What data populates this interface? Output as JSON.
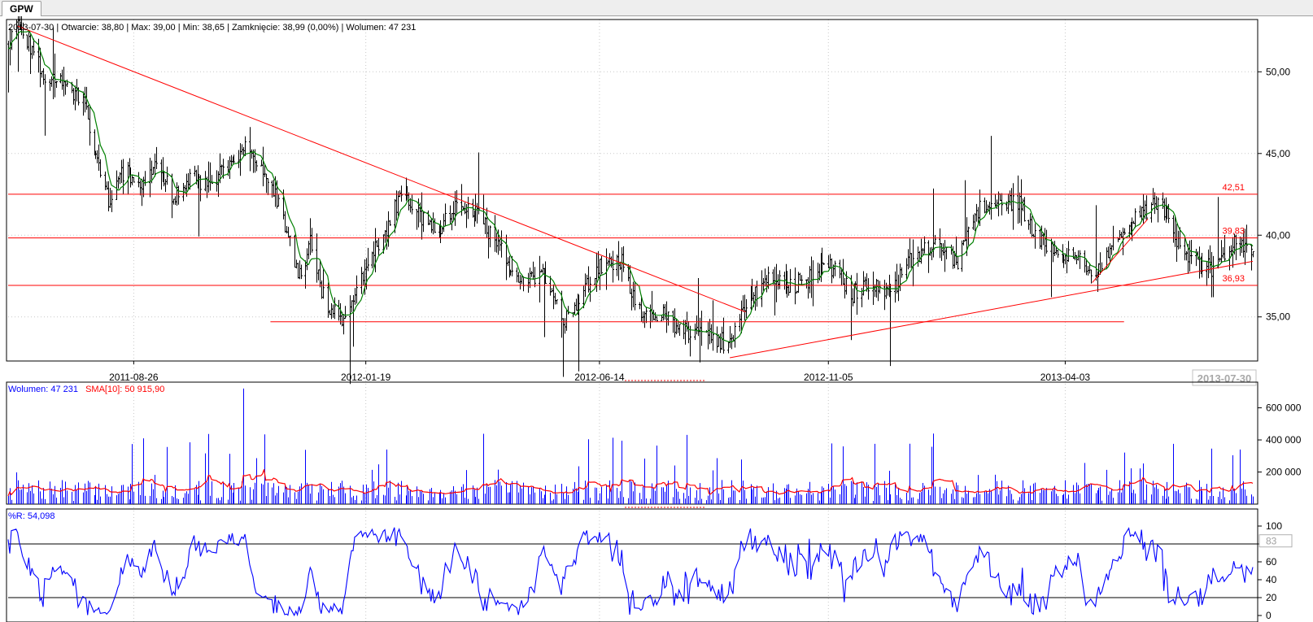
{
  "tab": {
    "label": "GPW"
  },
  "info": {
    "ohlc": "2013-07-30 | Otwarcie: 38,80 | Max: 39,00 | Min: 38,65 | Zamknięcie: 38,99 (0,00%) | Wolumen: 47 231",
    "volume_label": "Wolumen: 47 231",
    "sma_label": "SMA[10]: 50 915,90",
    "wr_label": "%R: 54,098"
  },
  "colors": {
    "candle": "#000000",
    "sma": "#008000",
    "line": "#ff0000",
    "volume": "#0000ff",
    "wr": "#0000ff"
  },
  "chart_data": [
    {
      "type": "candlestick",
      "y_ticks": [
        "50,00",
        "45,00",
        "40,00",
        "35,00"
      ],
      "y_tick_values": [
        50,
        45,
        40,
        35
      ],
      "ylim": [
        32.3,
        53.2
      ],
      "x_ticks": [
        "2011-08-26",
        "2012-01-19",
        "2012-06-14",
        "2012-11-05",
        "2013-04-03"
      ],
      "x_tick_values": [
        "2011-08-26",
        "2012-01-19",
        "2012-06-14",
        "2012-11-05",
        "2013-04-03"
      ],
      "last_date": "2013-07-30",
      "x_range": [
        "2011-06-08",
        "2013-07-30"
      ],
      "price_path": [
        [
          "2011-06-08",
          51.7
        ],
        [
          "2011-06-14",
          52.8
        ],
        [
          "2011-06-22",
          51.5
        ],
        [
          "2011-07-02",
          49.5
        ],
        [
          "2011-07-12",
          49.2
        ],
        [
          "2011-07-25",
          48.3
        ],
        [
          "2011-08-01",
          45.0
        ],
        [
          "2011-08-10",
          42.0
        ],
        [
          "2011-08-20",
          44.0
        ],
        [
          "2011-09-01",
          43.0
        ],
        [
          "2011-09-10",
          44.5
        ],
        [
          "2011-09-20",
          42.3
        ],
        [
          "2011-10-01",
          43.5
        ],
        [
          "2011-10-12",
          43.0
        ],
        [
          "2011-10-25",
          44.5
        ],
        [
          "2011-11-05",
          45.3
        ],
        [
          "2011-11-20",
          43.5
        ],
        [
          "2011-11-30",
          40.0
        ],
        [
          "2011-12-08",
          37.5
        ],
        [
          "2011-12-15",
          39.5
        ],
        [
          "2011-12-25",
          35.5
        ],
        [
          "2012-01-05",
          35.0
        ],
        [
          "2012-01-19",
          38.0
        ],
        [
          "2012-02-01",
          40.5
        ],
        [
          "2012-02-10",
          42.5
        ],
        [
          "2012-02-20",
          41.3
        ],
        [
          "2012-03-05",
          40.5
        ],
        [
          "2012-03-15",
          41.8
        ],
        [
          "2012-03-28",
          41.5
        ],
        [
          "2012-04-10",
          39.5
        ],
        [
          "2012-04-25",
          37.0
        ],
        [
          "2012-05-10",
          37.5
        ],
        [
          "2012-05-22",
          34.5
        ],
        [
          "2012-06-02",
          36.5
        ],
        [
          "2012-06-14",
          38.0
        ],
        [
          "2012-06-28",
          38.3
        ],
        [
          "2012-07-08",
          35.5
        ],
        [
          "2012-07-25",
          35.0
        ],
        [
          "2012-08-08",
          34.0
        ],
        [
          "2012-08-25",
          33.8
        ],
        [
          "2012-09-04",
          33.2
        ],
        [
          "2012-09-14",
          36.0
        ],
        [
          "2012-09-28",
          37.2
        ],
        [
          "2012-10-15",
          37.0
        ],
        [
          "2012-10-28",
          37.5
        ],
        [
          "2012-11-05",
          38.3
        ],
        [
          "2012-11-20",
          36.4
        ],
        [
          "2012-12-01",
          37.2
        ],
        [
          "2012-12-15",
          36.3
        ],
        [
          "2012-12-25",
          38.5
        ],
        [
          "2013-01-10",
          39.3
        ],
        [
          "2013-01-25",
          38.5
        ],
        [
          "2013-02-05",
          41.5
        ],
        [
          "2013-02-15",
          42.0
        ],
        [
          "2013-03-05",
          42.0
        ],
        [
          "2013-03-15",
          40.0
        ],
        [
          "2013-03-28",
          38.8
        ],
        [
          "2013-04-10",
          39.0
        ],
        [
          "2013-04-20",
          37.2
        ],
        [
          "2013-04-30",
          39.0
        ],
        [
          "2013-05-15",
          40.8
        ],
        [
          "2013-05-28",
          41.8
        ],
        [
          "2013-06-08",
          41.5
        ],
        [
          "2013-06-14",
          39.0
        ],
        [
          "2013-06-25",
          38.3
        ],
        [
          "2013-07-05",
          38.0
        ],
        [
          "2013-07-16",
          39.5
        ],
        [
          "2013-07-30",
          38.99
        ]
      ],
      "last_candle": {
        "date": "2013-07-30",
        "open": 38.8,
        "high": 39.0,
        "low": 38.65,
        "close": 38.99
      },
      "horizontal_lines": [
        {
          "value": 42.51,
          "label": "42,51"
        },
        {
          "value": 39.83,
          "label": "39,83"
        },
        {
          "value": 36.93,
          "label": "36,93"
        }
      ],
      "segment_lines": [
        {
          "from": [
            "2011-06-14",
            52.8
          ],
          "to": [
            "2012-09-14",
            35.3
          ]
        },
        {
          "from": [
            "2011-11-20",
            34.7
          ],
          "to": [
            "2013-05-10",
            34.7
          ]
        },
        {
          "from": [
            "2012-09-04",
            32.5
          ],
          "to": [
            "2013-07-30",
            38.4
          ]
        },
        {
          "from": [
            "2013-04-20",
            37.1
          ],
          "to": [
            "2013-05-25",
            41.0
          ]
        }
      ],
      "sma_series_name": "",
      "y_axis_side": "right",
      "grid": true
    },
    {
      "type": "bar",
      "title": "Wolumen: 47 231",
      "series": [
        {
          "name": "Wolumen",
          "last": 47231,
          "peak": 720000
        },
        {
          "name": "SMA[10]",
          "last": 50915.9
        }
      ],
      "y_ticks": [
        "600 000",
        "400 000",
        "200 000"
      ],
      "y_tick_values": [
        600000,
        400000,
        200000
      ],
      "ylim": [
        0,
        760000
      ],
      "typical_range": [
        20000,
        150000
      ]
    },
    {
      "type": "line",
      "title": "%R: 54,098",
      "last": 54.098,
      "y_ticks": [
        "100",
        "80",
        "60",
        "40",
        "20",
        "0"
      ],
      "y_tick_values": [
        100,
        80,
        60,
        40,
        20,
        0
      ],
      "ylim": [
        0,
        100
      ],
      "levels": [
        80,
        20
      ],
      "cursor_label": "83"
    }
  ]
}
